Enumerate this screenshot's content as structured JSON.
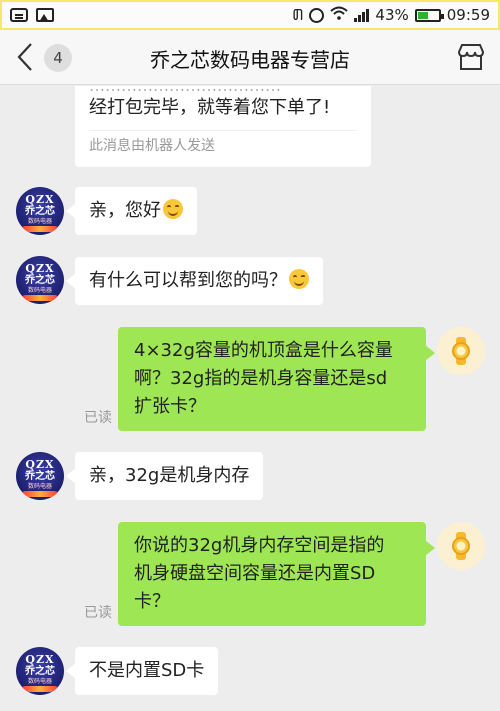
{
  "status_bar": {
    "battery_percent": "43%",
    "time": "09:59",
    "icons": [
      "message-icon",
      "image-icon",
      "bluetooth-icon",
      "alarm-icon",
      "wifi-icon",
      "signal-icon",
      "battery-icon"
    ]
  },
  "header": {
    "unread_count": "4",
    "title": "乔之芯数码电器专营店",
    "back_icon": "chevron-left-icon",
    "store_icon": "store-icon"
  },
  "avatar": {
    "shop_line1": "QZX",
    "shop_line2": "乔之芯",
    "shop_line3": "数码电器"
  },
  "messages": [
    {
      "side": "left",
      "text": "经打包完毕，就等着您下单了!",
      "note": "此消息由机器人发送"
    },
    {
      "side": "left",
      "text": "亲，您好",
      "emoji": "smile-emoji"
    },
    {
      "side": "left",
      "text": "有什么可以帮到您的吗？",
      "emoji": "smile-emoji"
    },
    {
      "side": "right",
      "lines": [
        "4×32g容量的机顶盒是什么容量",
        "啊？32g指的是机身容量还是sd",
        "扩张卡？"
      ],
      "read": "已读"
    },
    {
      "side": "left",
      "text": "亲，32g是机身内存"
    },
    {
      "side": "right",
      "lines": [
        "你说的32g机身内存空间是指的",
        "机身硬盘空间容量还是内置SD",
        "卡？"
      ],
      "read": "已读"
    },
    {
      "side": "left",
      "text": "不是内置SD卡"
    }
  ],
  "colors": {
    "sent_bubble": "#9ee654",
    "received_bubble": "#ffffff",
    "background": "#ededed",
    "avatar_shop": "#1c1f6d"
  }
}
